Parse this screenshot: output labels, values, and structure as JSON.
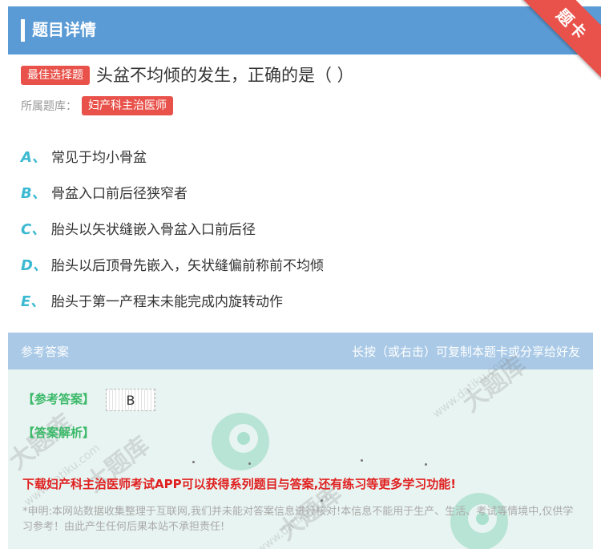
{
  "header": {
    "title": "题目详情",
    "corner_label": "题卡"
  },
  "question": {
    "tag": "最佳选择题",
    "text": "头盆不均倾的发生，正确的是（  ）",
    "bank_label": "所属题库：",
    "bank_name": "妇产科主治医师"
  },
  "options": [
    {
      "letter": "A、",
      "text": "常见于均小骨盆"
    },
    {
      "letter": "B、",
      "text": "骨盆入口前后径狭窄者"
    },
    {
      "letter": "C、",
      "text": "胎头以矢状缝嵌入骨盆入口前后径"
    },
    {
      "letter": "D、",
      "text": "胎头以后顶骨先嵌入，矢状缝偏前称前不均倾"
    },
    {
      "letter": "E、",
      "text": "胎头于第一产程末未能完成内旋转动作"
    }
  ],
  "answer": {
    "section_title": "参考答案",
    "hint": "长按（或右击）可复制本题卡或分享给好友",
    "answer_label": "【参考答案】",
    "answer_value": "B",
    "analysis_label": "【答案解析】",
    "promo": "下载妇产科主治医师考试APP可以获得系列题目与答案,还有练习等更多学习功能!",
    "disclaimer": "*申明:本网站数据收集整理于互联网,我们并未能对答案信息进行核对!本信息不能用于生产、生活、考试等情境中,仅供学习参考！由此产生任何后果本站不承担责任!"
  },
  "watermark": {
    "text": "大题库",
    "url": "www.datiku.com"
  },
  "colors": {
    "header_blue": "#5b9bd5",
    "tag_red": "#e8524a",
    "option_letter": "#3cb9d1",
    "answer_green": "#3cb96a",
    "promo_red": "#e02020"
  }
}
